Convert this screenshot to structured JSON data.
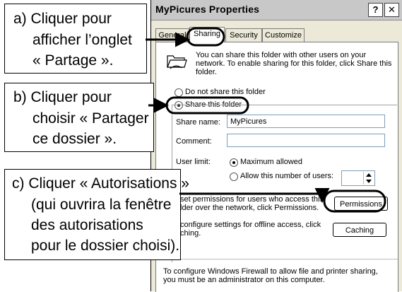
{
  "dialog": {
    "title": "MyPicures Properties",
    "help_label": "?",
    "close_label": "✕",
    "tabs": [
      "General",
      "Sharing",
      "Security",
      "Customize"
    ],
    "active_tab": "Sharing",
    "intro_text": "You can share this folder with other users on your network.  To enable sharing for this folder, click Share this folder.",
    "do_not_share_label": "Do not share this folder",
    "share_label": "Share this folder",
    "share_name_label": "Share name:",
    "share_name_value": "MyPicures",
    "comment_label": "Comment:",
    "comment_value": "",
    "user_limit_label": "User limit:",
    "max_allowed_label": "Maximum allowed",
    "allow_number_label": "Allow this number of users:",
    "permissions_text_visible": [
      "set permissions for users who access this",
      "lder over the network, click Permissions."
    ],
    "permissions_button": "Permissions",
    "caching_text_visible": [
      "configure settings for offline access, click",
      "ching."
    ],
    "caching_button": "Caching",
    "firewall_text": [
      "To configure Windows Firewall to allow file and printer sharing,",
      "you must be an administrator on this computer."
    ]
  },
  "callouts": {
    "a": [
      "a) Cliquer pour",
      "afficher l’onglet",
      "« Partage »."
    ],
    "b": [
      "b) Cliquer pour",
      "choisir « Partager",
      "ce dossier »."
    ],
    "c": [
      "c) Cliquer « Autorisations »",
      "(qui ouvrira la fenêtre",
      "des autorisations",
      "pour le dossier choisi)."
    ]
  }
}
